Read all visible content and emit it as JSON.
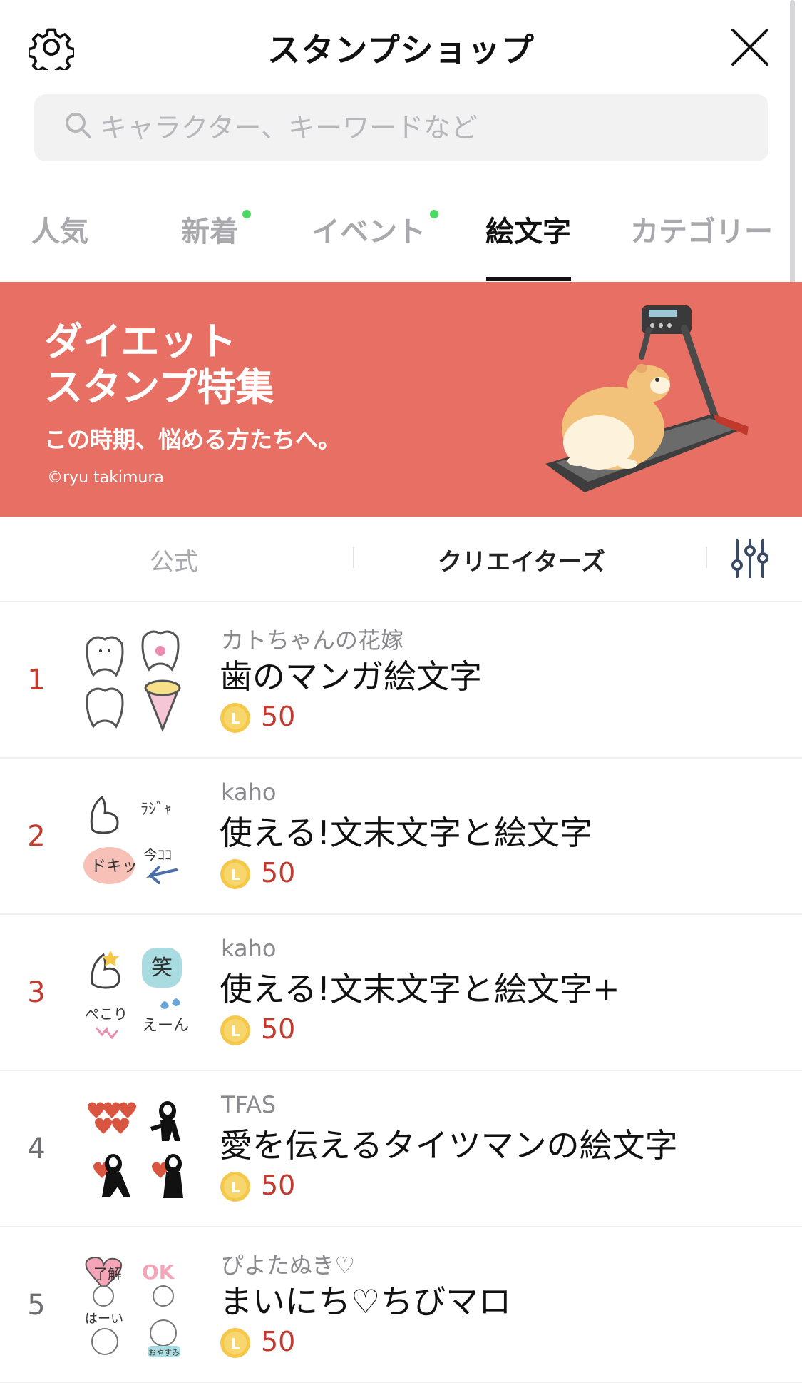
{
  "header": {
    "title": "スタンプショップ",
    "settings_icon": "gear-icon",
    "close_icon": "close-icon"
  },
  "search": {
    "placeholder": "キャラクター、キーワードなど",
    "value": "",
    "icon": "search-icon"
  },
  "tabs": [
    {
      "label": "人気",
      "active": false,
      "new_dot": false
    },
    {
      "label": "新着",
      "active": false,
      "new_dot": true
    },
    {
      "label": "イベント",
      "active": false,
      "new_dot": true
    },
    {
      "label": "絵文字",
      "active": true,
      "new_dot": false
    },
    {
      "label": "カテゴリー",
      "active": false,
      "new_dot": false
    }
  ],
  "banner": {
    "line1": "ダイエット",
    "line2": "スタンプ特集",
    "subtitle": "この時期、悩める方たちへ。",
    "credit": "©ryu takimura",
    "background_color": "#e76f63"
  },
  "subtabs": {
    "official": "公式",
    "creators": "クリエイターズ",
    "active": "creators",
    "filter_icon": "filter-sliders-icon"
  },
  "colors": {
    "accent_red": "#c33a30",
    "new_dot_green": "#4cd963",
    "coin_yellow": "#f5c84a"
  },
  "items": [
    {
      "rank": "1",
      "author": "カトちゃんの花嫁",
      "name": "歯のマンガ絵文字",
      "price": "50"
    },
    {
      "rank": "2",
      "author": "kaho",
      "name": "使える!文末文字と絵文字",
      "price": "50"
    },
    {
      "rank": "3",
      "author": "kaho",
      "name": "使える!文末文字と絵文字+",
      "price": "50"
    },
    {
      "rank": "4",
      "author": "TFAS",
      "name": "愛を伝えるタイツマンの絵文字",
      "price": "50"
    },
    {
      "rank": "5",
      "author": "ぴよたぬき♡",
      "name": "まいにち♡ちびマロ",
      "price": "50"
    }
  ]
}
